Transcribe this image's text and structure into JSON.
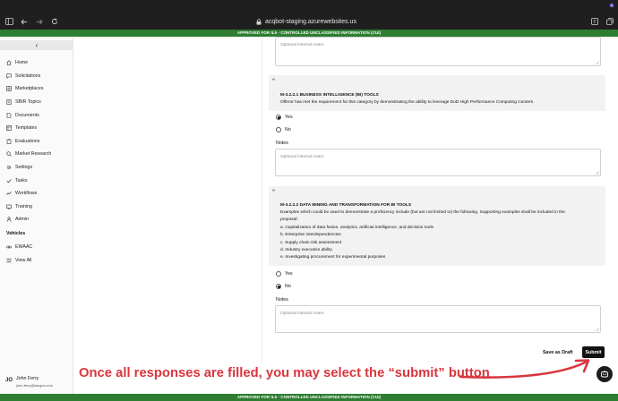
{
  "browser": {
    "url": "acqbot-staging.azurewebsites.us",
    "cui_banner": "APPROVED FOR IL5 - CONTROLLED UNCLASSIFIED INFORMATION (CUI)"
  },
  "sidebar": {
    "collapse_glyph": "‹",
    "items": [
      {
        "label": "Home",
        "icon": "home-icon"
      },
      {
        "label": "Solicitations",
        "icon": "chat-icon"
      },
      {
        "label": "Marketplaces",
        "icon": "grid-icon"
      },
      {
        "label": "SBIR Topics",
        "icon": "book-icon"
      },
      {
        "label": "Documents",
        "icon": "document-icon"
      },
      {
        "label": "Templates",
        "icon": "template-icon"
      },
      {
        "label": "Evaluations",
        "icon": "clipboard-icon"
      },
      {
        "label": "Market Research",
        "icon": "search-icon"
      },
      {
        "label": "Settings",
        "icon": "gear-icon"
      },
      {
        "label": "Tasks",
        "icon": "check-icon"
      },
      {
        "label": "Workflows",
        "icon": "workflow-icon"
      },
      {
        "label": "Training",
        "icon": "training-icon"
      },
      {
        "label": "Admin",
        "icon": "person-icon"
      }
    ],
    "vehicles_title": "Vehicles",
    "vehicles": [
      {
        "label": "EWAAC",
        "icon": "link-icon"
      },
      {
        "label": "View All",
        "icon": "list-icon"
      }
    ],
    "user": {
      "initials": "JO",
      "name": "John Ferry",
      "email": "john.ferry@tacgov.com"
    }
  },
  "form": {
    "notes_placeholder": "Optional internal notes.",
    "notes_label": "Notes",
    "questions": [
      {
        "quote": "“",
        "title": "M-3.2.2.1 BUSINESS INTELLIGENCE (BI) TOOLS",
        "lines": [
          "Offeror has met the requirement for this category by demonstrating the ability to leverage DoD High Performance Computing Centers."
        ],
        "options": [
          {
            "label": "Yes",
            "selected": true
          },
          {
            "label": "No",
            "selected": false
          }
        ]
      },
      {
        "quote": "“",
        "title": "M-3.2.2.2 DATA MINING AND TRANSFORMATION FOR BI TOOLS",
        "lines": [
          "Examples which could be used to demonstrate a proficiency include (but are not limited to) the following.  Supporting examples shall be included in the",
          "proposal:",
          "a. Capitalization of data fusion, analytics, artificial intelligence, and decision tools",
          "b. Enterprise interdependencies",
          "c. Supply chain risk assessment",
          "d. Industry execution ability",
          "e. Investigating procurement for experimental purposes"
        ],
        "options": [
          {
            "label": "Yes",
            "selected": false
          },
          {
            "label": "No",
            "selected": true
          }
        ]
      }
    ],
    "save_draft_label": "Save as Draft",
    "submit_label": "Submit"
  },
  "annotation": {
    "text": "Once all responses are filled, you may select the “submit” button",
    "color": "#d9363e"
  }
}
